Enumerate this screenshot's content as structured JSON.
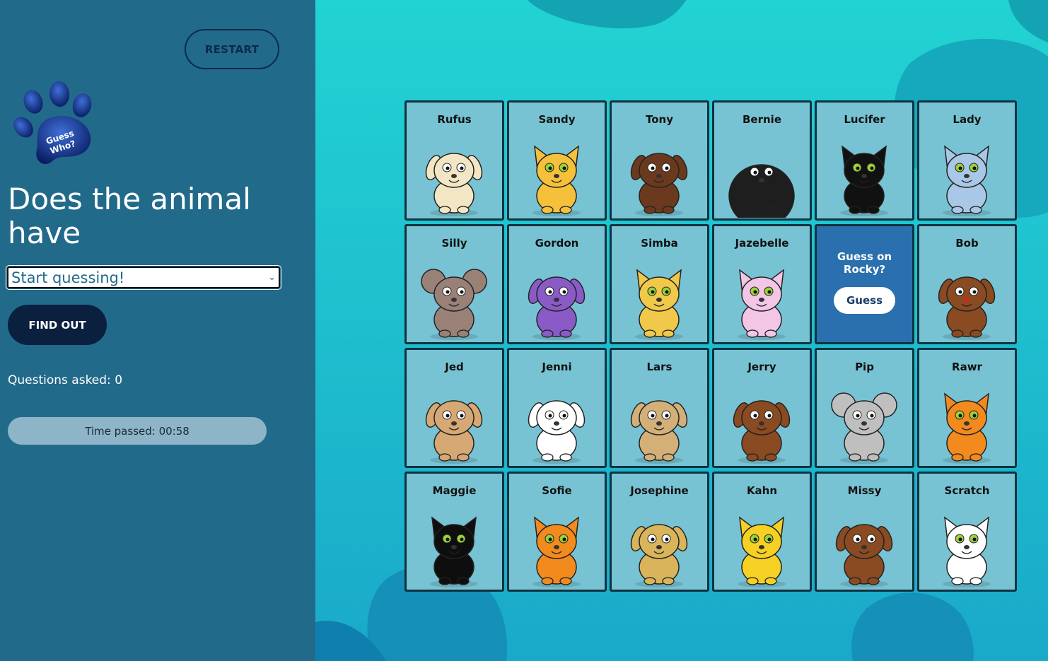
{
  "sidebar": {
    "restart_label": "RESTART",
    "logo_text_line1": "Guess",
    "logo_text_line2": "Who?",
    "question_title": "Does the animal have",
    "select_value": "Start quessing!",
    "findout_label": "FIND OUT",
    "questions_asked": "Questions asked: 0",
    "time_passed": "Time passed: 00:58"
  },
  "guess_card": {
    "prompt": "Guess on Rocky?",
    "button_label": "Guess"
  },
  "cards": [
    {
      "name": "Rufus",
      "kind": "pug-dog-icon",
      "color": "#f2e6c4"
    },
    {
      "name": "Sandy",
      "kind": "yellow-cat-icon",
      "color": "#f6c13a"
    },
    {
      "name": "Tony",
      "kind": "chihuahua-icon",
      "color": "#6b3a1e"
    },
    {
      "name": "Bernie",
      "kind": "black-sheep-icon",
      "color": "#1e1e1e"
    },
    {
      "name": "Lucifer",
      "kind": "tuxedo-cat-icon",
      "color": "#111111"
    },
    {
      "name": "Lady",
      "kind": "blue-kitten-icon",
      "color": "#a9c7e6"
    },
    {
      "name": "Silly",
      "kind": "mouse-icon",
      "color": "#9a8177"
    },
    {
      "name": "Gordon",
      "kind": "purple-dog-icon",
      "color": "#8a5bc7"
    },
    {
      "name": "Simba",
      "kind": "leopard-cub-icon",
      "color": "#f1c94a"
    },
    {
      "name": "Jazebelle",
      "kind": "pink-unicorn-cat-icon",
      "color": "#f3c6e6"
    },
    {
      "name": "Rocky",
      "kind": "guess-card",
      "color": "#2a6fae"
    },
    {
      "name": "Bob",
      "kind": "brown-dog-glasses-icon",
      "color": "#8a4a22"
    },
    {
      "name": "Jed",
      "kind": "tan-dog-icon",
      "color": "#d6a874"
    },
    {
      "name": "Jenni",
      "kind": "white-dog-icon",
      "color": "#ffffff"
    },
    {
      "name": "Lars",
      "kind": "tan-puppy-icon",
      "color": "#d2b078"
    },
    {
      "name": "Jerry",
      "kind": "brown-puppy-icon",
      "color": "#8a4a22"
    },
    {
      "name": "Pip",
      "kind": "grey-mouse-icon",
      "color": "#bfbfbf"
    },
    {
      "name": "Rawr",
      "kind": "orange-tiger-icon",
      "color": "#f28a1e"
    },
    {
      "name": "Maggie",
      "kind": "black-cat-icon",
      "color": "#0e0e0e"
    },
    {
      "name": "Sofie",
      "kind": "orange-cat-icon",
      "color": "#f28a1e"
    },
    {
      "name": "Josephine",
      "kind": "yellow-dog-icon",
      "color": "#d9b45a"
    },
    {
      "name": "Kahn",
      "kind": "spotted-cat-icon",
      "color": "#f6d023"
    },
    {
      "name": "Missy",
      "kind": "brown-hedgehog-icon",
      "color": "#8a4a22"
    },
    {
      "name": "Scratch",
      "kind": "white-cat-icon",
      "color": "#ffffff"
    }
  ],
  "colors": {
    "sidebar_bg": "#226a8a",
    "board_bg": "#1ec6cc",
    "card_bg": "#78c3d3",
    "guess_card_bg": "#2a6fae",
    "dark_navy": "#0b1f3f"
  }
}
